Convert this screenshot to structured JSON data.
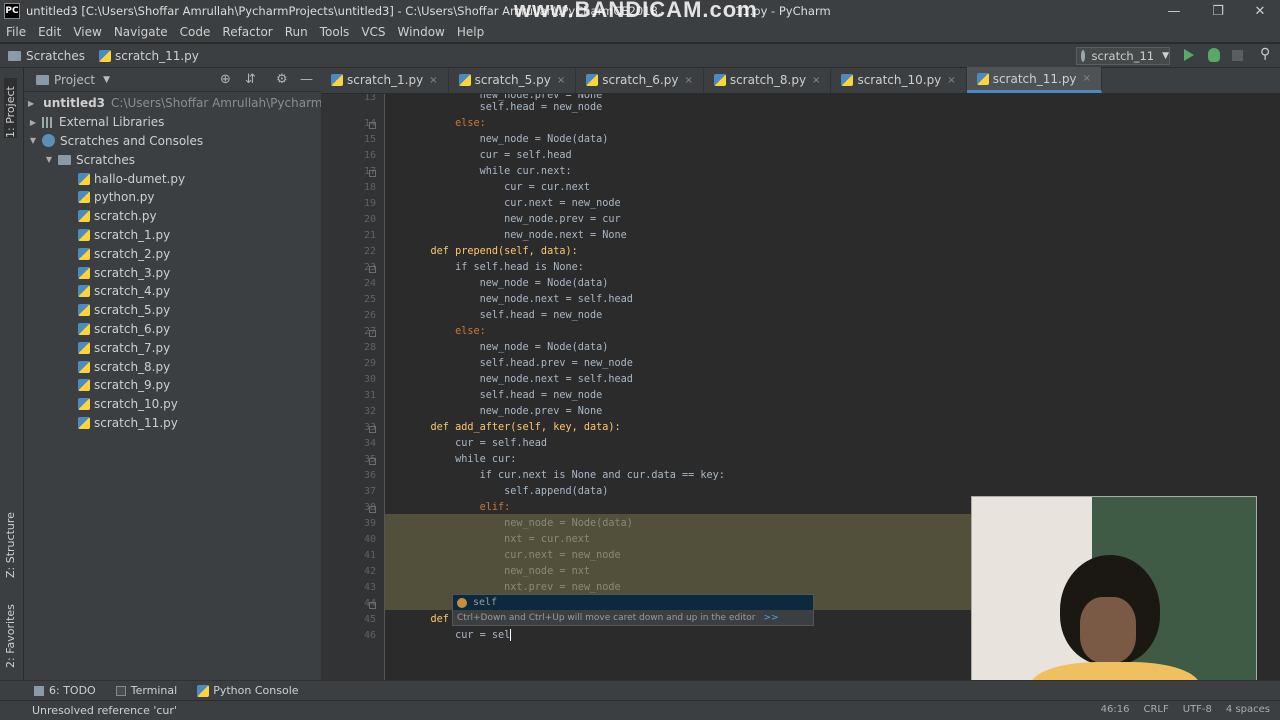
{
  "window": {
    "title": "untitled3 [C:\\Users\\Shoffar Amrullah\\PycharmProjects\\untitled3] - C:\\Users\\Shoffar Amrullah\\.PyCharmCE2018.",
    "title_end": "11.py - PyCharm",
    "watermark": "www.BANDICAM.com",
    "app_icon": "PC"
  },
  "menu": [
    "File",
    "Edit",
    "View",
    "Navigate",
    "Code",
    "Refactor",
    "Run",
    "Tools",
    "VCS",
    "Window",
    "Help"
  ],
  "breadcrumb": {
    "root": "Scratches",
    "file": "scratch_11.py"
  },
  "run_config": {
    "label": "scratch_11"
  },
  "left_strip": {
    "project_tab": "1: Project",
    "structure_tab": "Z: Structure",
    "favorites_tab": "2: Favorites"
  },
  "project": {
    "header": "Project",
    "tree": [
      {
        "label": "untitled3",
        "hint": "C:\\Users\\Shoffar Amrullah\\PycharmProjec",
        "indent": 0
      },
      {
        "label": "External Libraries",
        "indent": 0
      },
      {
        "label": "Scratches and Consoles",
        "indent": 0
      },
      {
        "label": "Scratches",
        "indent": 1
      },
      {
        "label": "hallo-dumet.py",
        "indent": 2
      },
      {
        "label": "python.py",
        "indent": 2
      },
      {
        "label": "scratch.py",
        "indent": 2
      },
      {
        "label": "scratch_1.py",
        "indent": 2
      },
      {
        "label": "scratch_2.py",
        "indent": 2
      },
      {
        "label": "scratch_3.py",
        "indent": 2
      },
      {
        "label": "scratch_4.py",
        "indent": 2
      },
      {
        "label": "scratch_5.py",
        "indent": 2
      },
      {
        "label": "scratch_6.py",
        "indent": 2
      },
      {
        "label": "scratch_7.py",
        "indent": 2
      },
      {
        "label": "scratch_8.py",
        "indent": 2
      },
      {
        "label": "scratch_9.py",
        "indent": 2
      },
      {
        "label": "scratch_10.py",
        "indent": 2
      },
      {
        "label": "scratch_11.py",
        "indent": 2
      }
    ]
  },
  "tabs": [
    "scratch_1.py",
    "scratch_5.py",
    "scratch_6.py",
    "scratch_8.py",
    "scratch_10.py",
    "scratch_11.py"
  ],
  "editor": {
    "line_numbers": [
      "13",
      "14",
      "15",
      "16",
      "17",
      "18",
      "19",
      "20",
      "21",
      "22",
      "23",
      "24",
      "25",
      "26",
      "27",
      "28",
      "29",
      "30",
      "31",
      "32",
      "33",
      "34",
      "35",
      "36",
      "37",
      "38",
      "39",
      "40",
      "41",
      "42",
      "43",
      "44",
      "45",
      "46"
    ],
    "code_lines": [
      "            new_node.prev = None",
      "            self.head = new_node",
      "        else:",
      "            new_node = Node(data)",
      "            cur = self.head",
      "            while cur.next:",
      "                cur = cur.next",
      "                cur.next = new_node",
      "                new_node.prev = cur",
      "                new_node.next = None",
      "    def prepend(self, data):",
      "        if self.head is None:",
      "            new_node = Node(data)",
      "            new_node.next = self.head",
      "            self.head = new_node",
      "        else:",
      "            new_node = Node(data)",
      "            self.head.prev = new_node",
      "            new_node.next = self.head",
      "            self.head = new_node",
      "            new_node.prev = None",
      "    def add_after(self, key, data):",
      "        cur = self.head",
      "        while cur:",
      "            if cur.next is None and cur.data == key:",
      "                self.append(data)",
      "            elif:",
      "                new_node = Node(data)",
      "                nxt = cur.next",
      "                cur.next = new_node",
      "                new_node = nxt",
      "                nxt.prev = new_node",
      "",
      "    def add",
      "        cur = sel"
    ]
  },
  "completion": {
    "suggestion": "self",
    "hint": "Ctrl+Down and Ctrl+Up will move caret down and up in the editor",
    "more": ">>"
  },
  "bottom_tabs": [
    "6: TODO",
    "Terminal",
    "Python Console"
  ],
  "status": {
    "message": "Unresolved reference 'cur'",
    "position": "46:16",
    "line_sep": "CRLF",
    "encoding": "UTF-8",
    "indent": "4 spaces"
  }
}
